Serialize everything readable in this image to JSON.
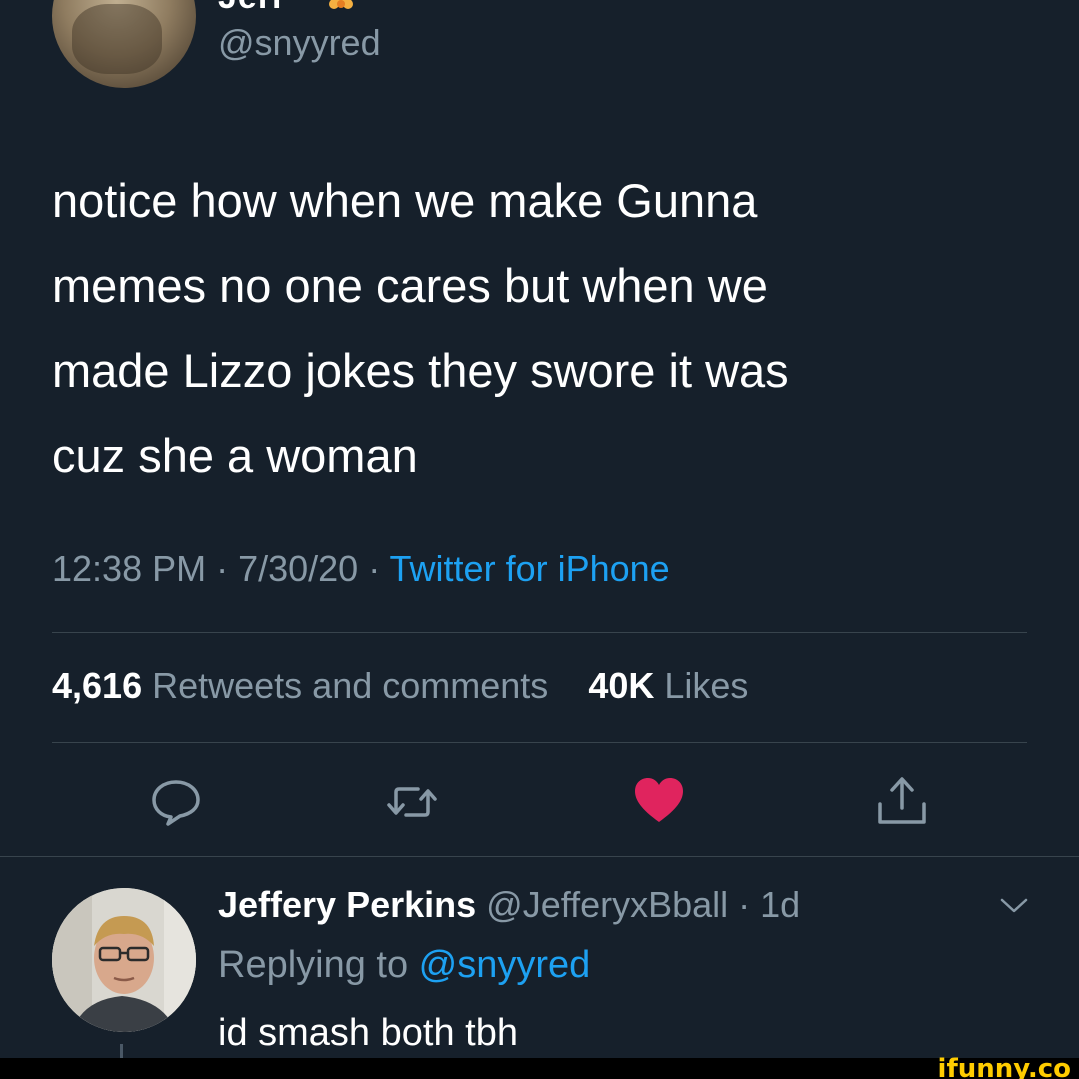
{
  "tweet": {
    "author_name": "Jerr",
    "author_handle": "@snyyred",
    "text": "notice how when we make Gunna\nmemes no one cares but when we\nmade Lizzo jokes they swore it was\ncuz she a woman",
    "time": "12:38 PM · 7/30/20 · ",
    "source": "Twitter for iPhone",
    "retweets_count": "4,616",
    "retweets_label": "Retweets and comments",
    "likes_count": "40K",
    "likes_label": "Likes"
  },
  "actions": {
    "reply_icon": "reply-icon",
    "retweet_icon": "retweet-icon",
    "like_icon": "heart-icon",
    "share_icon": "share-icon",
    "liked": true,
    "like_color": "#e0245e"
  },
  "reply": {
    "name": "Jeffery Perkins",
    "handle_time": " @JefferyxBball · 1d",
    "replying_label": "Replying to ",
    "replying_mention": "@snyyred",
    "text": "id smash both tbh"
  },
  "watermark": "ifunny.co",
  "colors": {
    "background": "#16202b",
    "muted": "#8899a6",
    "accent": "#1da1f2",
    "like": "#e0245e",
    "watermark": "#ffcc00"
  }
}
